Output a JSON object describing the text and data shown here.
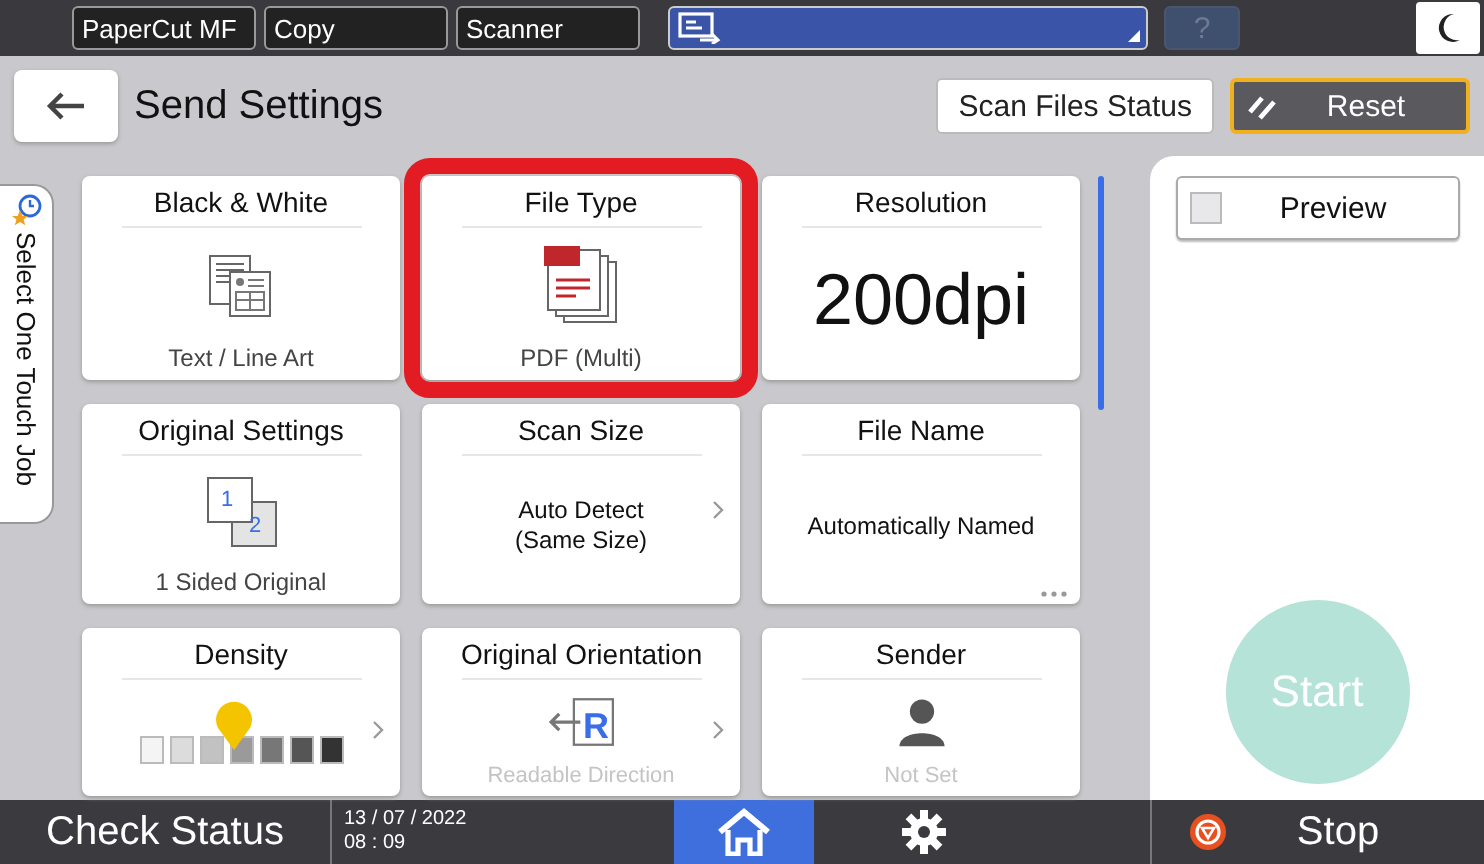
{
  "top_bar": {
    "tabs": [
      {
        "label": "PaperCut MF",
        "selected": false
      },
      {
        "label": "Copy",
        "selected": false
      },
      {
        "label": "Scanner",
        "selected": false
      }
    ],
    "help": {
      "label": "?",
      "disabled": true
    }
  },
  "header": {
    "title": "Send Settings",
    "buttons": [
      {
        "label": "Scan Files Status",
        "kind": "plain",
        "highlighted": false
      },
      {
        "label": "Reset",
        "kind": "reset",
        "highlighted": true
      }
    ]
  },
  "side_tab": {
    "label": "Select One Touch Job"
  },
  "cards": [
    {
      "title": "Black & White",
      "kind": "text-doc",
      "value": "Text / Line Art",
      "selected": false,
      "arrow": false,
      "more": false
    },
    {
      "title": "File Type",
      "kind": "pdf",
      "value": "PDF (Multi)",
      "selected": true,
      "arrow": false,
      "more": false
    },
    {
      "title": "Resolution",
      "kind": "big",
      "value": "200dpi",
      "selected": false,
      "arrow": false,
      "more": false
    },
    {
      "title": "Original Settings",
      "kind": "sided",
      "icon_labels": [
        "1",
        "2"
      ],
      "value": "1 Sided Original",
      "selected": false,
      "arrow": false,
      "more": false
    },
    {
      "title": "Scan Size",
      "kind": "text",
      "value": "Auto Detect\n(Same Size)",
      "selected": false,
      "arrow": true,
      "more": false
    },
    {
      "title": "File Name",
      "kind": "text",
      "value": "Automatically Named",
      "selected": false,
      "arrow": false,
      "more": true
    },
    {
      "title": "Density",
      "kind": "density",
      "level": 0.5,
      "selected": false,
      "arrow": true,
      "more": false
    },
    {
      "title": "Original Orientation",
      "kind": "orientation",
      "icon_labels": [
        "R"
      ],
      "value": "Readable Direction",
      "selected": false,
      "arrow": true,
      "more": false
    },
    {
      "title": "Sender",
      "kind": "person",
      "value": "Not Set",
      "selected": false,
      "arrow": false,
      "more": false
    }
  ],
  "right_panel": {
    "preview": {
      "label": "Preview",
      "checked": false
    },
    "start": {
      "label": "Start",
      "disabled": true
    }
  },
  "status_bar": {
    "check_status": "Check Status",
    "date": "13 / 07 / 2022",
    "time": "08 : 09",
    "stop": "Stop"
  }
}
